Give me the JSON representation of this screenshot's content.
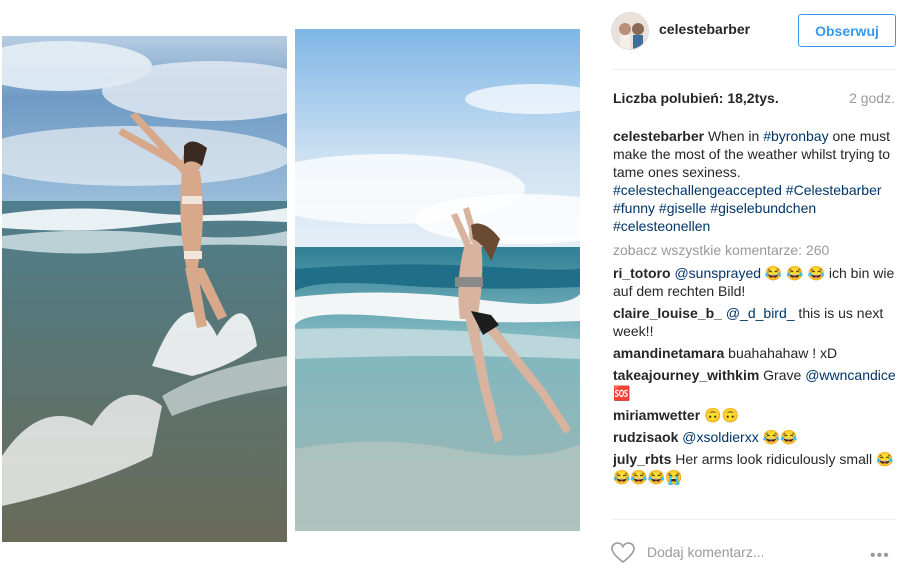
{
  "post": {
    "username": "celestebarber",
    "follow_label": "Obserwuj",
    "likes": "Liczba polubień: 18,2tys.",
    "time": "2 godz.",
    "caption": {
      "user": "celestebarber",
      "text_1": " When in ",
      "tag_1": "#byronbay",
      "text_2": " one must make the most of the weather whilst trying to tame ones sexiness. ",
      "tags": "#celestechallengeaccepted #Celestebarber #funny #giselle #giselebundchen #celesteonellen"
    },
    "view_all_comments": "zobacz wszystkie komentarze: 260",
    "add_comment_placeholder": "Dodaj komentarz...",
    "more_label": "•••"
  },
  "comments": [
    {
      "user": "ri_totoro",
      "mention": "@sunsprayed",
      "text": " 😂 😂 😂 ich bin wie auf dem rechten Bild!"
    },
    {
      "user": "claire_louise_b_",
      "mention": "@_d_bird_",
      "text": " this is us next week!!"
    },
    {
      "user": "amandinetamara",
      "mention": "",
      "text": " buahahahaw ! xD"
    },
    {
      "user": "takeajourney_withkim",
      "mention": "",
      "text": " Grave ",
      "mention_after": "@wwncandice",
      "text_after": " 🆘"
    },
    {
      "user": "miriamwetter",
      "mention": "",
      "text": " 🙃🙃"
    },
    {
      "user": "rudzisaok",
      "mention": "@xsoldierxx",
      "text": " 😂😂"
    },
    {
      "user": "july_rbts",
      "mention": "",
      "text": " Her arms look ridiculously small 😂😂😂😂😭"
    }
  ],
  "colors": {
    "accent": "#3897f0",
    "hashtag": "#003569",
    "muted": "#999999"
  },
  "icons": {
    "like": "heart-outline-icon",
    "more": "ellipsis-icon"
  }
}
